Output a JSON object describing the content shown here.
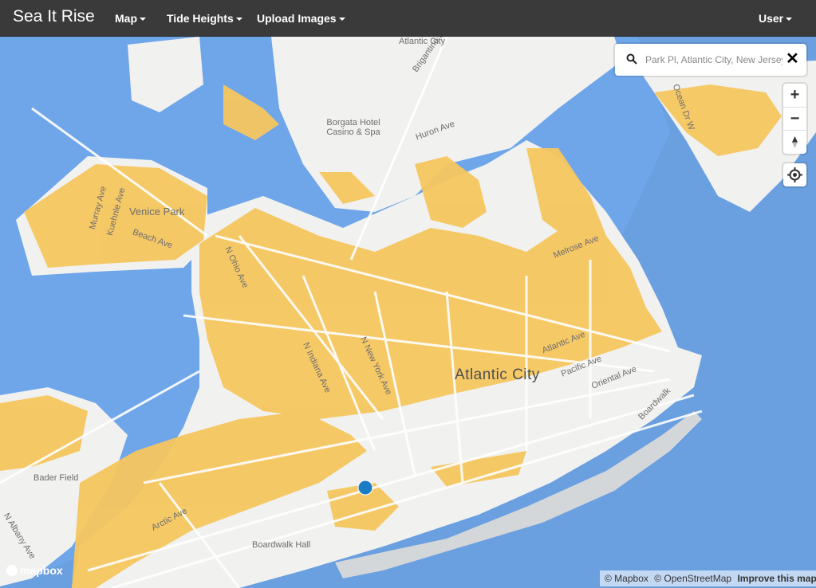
{
  "navbar": {
    "brand": "Sea It Rise",
    "menu": [
      {
        "label": "Map"
      },
      {
        "label": "Tide Heights"
      },
      {
        "label": "Upload Images"
      }
    ],
    "user": "User"
  },
  "search": {
    "value": "Park Pl, Atlantic City, New Jersey",
    "search_icon": "search-icon",
    "clear_icon": "close-icon"
  },
  "controls": {
    "zoom_in": "+",
    "zoom_out": "−",
    "compass_icon": "compass-icon",
    "geolocate_icon": "geolocate-icon"
  },
  "map_labels": {
    "atlantic_city_top": "Atlantic City",
    "brigantine_blvd": "Brigantine Blvd",
    "borgata": "Borgata Hotel Casino & Spa",
    "huron_ave": "Huron Ave",
    "venice_park": "Venice Park",
    "murray_ave": "Murray Ave",
    "kuehnle_ave": "Kuehnle Ave",
    "beach_ave": "Beach Ave",
    "n_ohio_ave": "N Ohio Ave",
    "n_indiana_ave": "N Indiana Ave",
    "n_new_york_ave": "N New York Ave",
    "melrose_ave": "Melrose Ave",
    "atlantic_ave": "Atlantic Ave",
    "atlantic_city_main": "Atlantic City",
    "pacific_ave": "Pacific Ave",
    "oriental_ave": "Oriental Ave",
    "boardwalk": "Boardwalk",
    "bader_field": "Bader Field",
    "arctic_ave": "Arctic Ave",
    "n_albany_ave": "N Albany Ave",
    "boardwalk_hall": "Boardwalk Hall",
    "ocean_dr": "Ocean Dr W"
  },
  "colors": {
    "water": "#6a9fe0",
    "land": "#f1f1f0",
    "flood": "#f6c65f",
    "marker": "#1a7cc2",
    "navbar": "#3a3a3a"
  },
  "footer": {
    "logo": "mapbox",
    "attribution_mapbox": "© Mapbox",
    "attribution_osm": "© OpenStreetMap",
    "improve": "Improve this map"
  }
}
